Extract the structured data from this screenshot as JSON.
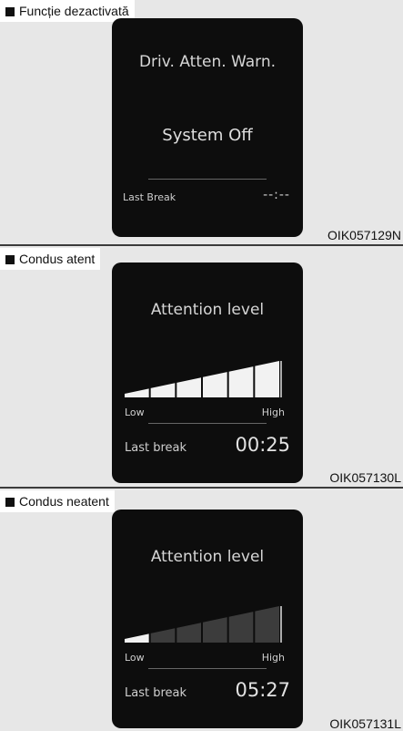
{
  "panels": [
    {
      "title": "Funcție dezactivată",
      "code": "OIK057129N",
      "screen": {
        "title": "Driv. Atten. Warn.",
        "status": "System Off",
        "last_break_label": "Last Break",
        "last_break_value": "--:--"
      }
    },
    {
      "title": "Condus atent",
      "code": "OIK057130L",
      "screen": {
        "title": "Attention level",
        "low_label": "Low",
        "high_label": "High",
        "attention_level": 1.0,
        "last_break_label": "Last break",
        "last_break_value": "00:25"
      }
    },
    {
      "title": "Condus neatent",
      "code": "OIK057131L",
      "screen": {
        "title": "Attention level",
        "low_label": "Low",
        "high_label": "High",
        "attention_level": 0.2,
        "last_break_label": "Last break",
        "last_break_value": "05:27"
      }
    }
  ],
  "colors": {
    "screen_bg": "#0d0d0d",
    "bar_active": "#f2f2f2",
    "bar_inactive": "#3c3c3c"
  }
}
